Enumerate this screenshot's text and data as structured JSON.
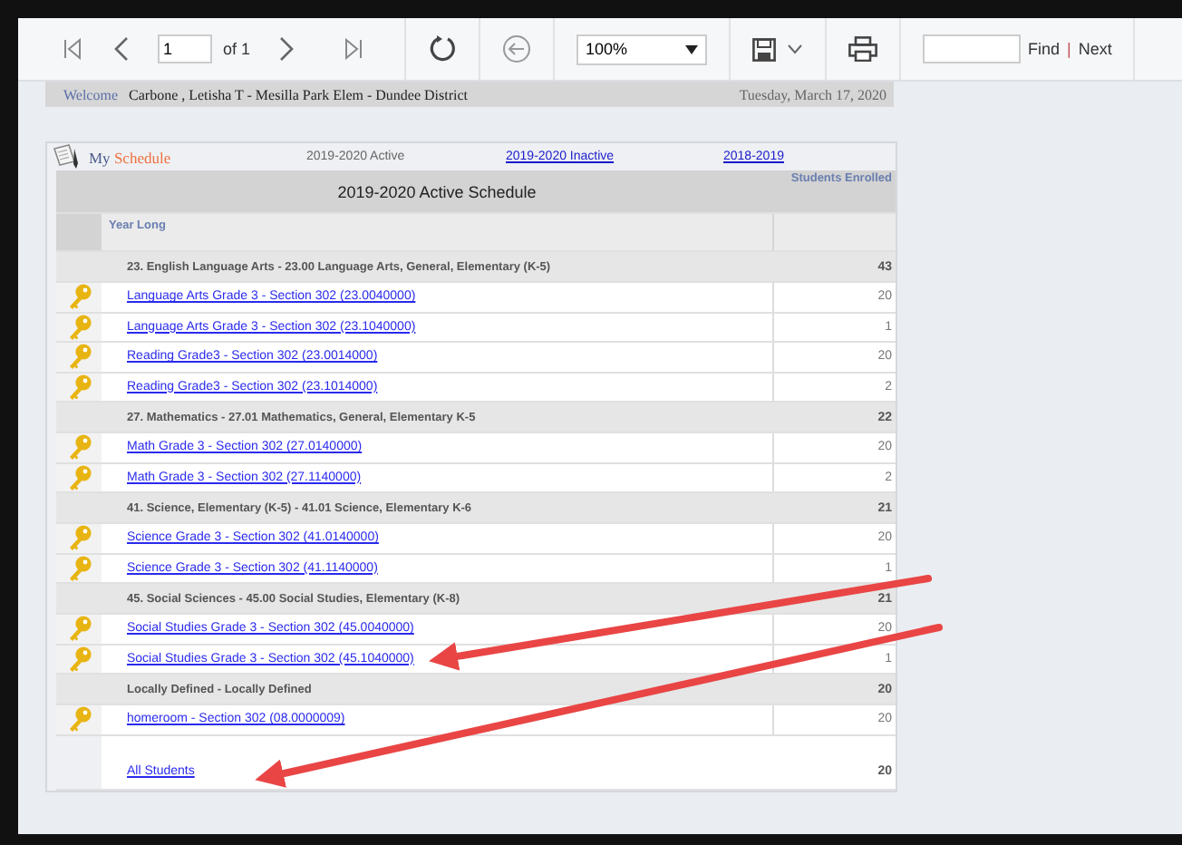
{
  "toolbar": {
    "page": "1",
    "page_count": "of 1",
    "zoom": "100%",
    "find_label": "Find",
    "separator": "|",
    "next_label": "Next"
  },
  "welcome": {
    "label": "Welcome",
    "user": "Carbone , Letisha T - Mesilla Park Elem - Dundee District",
    "date": "Tuesday, March 17, 2020"
  },
  "schedule": {
    "title_prefix": "My",
    "title_word": "Schedule",
    "years": [
      {
        "label": "2019-2020 Active",
        "selected": true
      },
      {
        "label": "2019-2020 Inactive",
        "selected": false
      },
      {
        "label": "2018-2019",
        "selected": false
      }
    ],
    "table_title": "2019-2020 Active Schedule",
    "count_column": "Students Enrolled",
    "term": "Year Long",
    "groups": [
      {
        "name": "23. English Language Arts - 23.00 Language Arts, General, Elementary (K-5)",
        "count": "43",
        "sections": [
          {
            "name": "Language Arts Grade 3 - Section 302 (23.0040000)",
            "count": "20"
          },
          {
            "name": "Language Arts Grade 3 - Section 302 (23.1040000)",
            "count": "1"
          },
          {
            "name": "Reading Grade3 - Section 302 (23.0014000)",
            "count": "20"
          },
          {
            "name": "Reading Grade3 - Section 302 (23.1014000)",
            "count": "2"
          }
        ]
      },
      {
        "name": "27. Mathematics - 27.01 Mathematics, General, Elementary K-5",
        "count": "22",
        "sections": [
          {
            "name": "Math Grade 3 - Section 302 (27.0140000)",
            "count": "20"
          },
          {
            "name": "Math Grade 3 - Section 302 (27.1140000)",
            "count": "2"
          }
        ]
      },
      {
        "name": "41. Science, Elementary (K-5) - 41.01 Science, Elementary K-6",
        "count": "21",
        "sections": [
          {
            "name": "Science Grade 3 - Section 302 (41.0140000)",
            "count": "20"
          },
          {
            "name": "Science Grade 3 - Section 302 (41.1140000)",
            "count": "1"
          }
        ]
      },
      {
        "name": "45. Social Sciences - 45.00 Social Studies, Elementary (K-8)",
        "count": "21",
        "sections": [
          {
            "name": "Social Studies Grade 3 - Section 302 (45.0040000)",
            "count": "20"
          },
          {
            "name": "Social Studies Grade 3 - Section 302 (45.1040000)",
            "count": "1"
          }
        ]
      },
      {
        "name": "Locally Defined - Locally Defined",
        "count": "20",
        "sections": [
          {
            "name": "homeroom - Section 302 (08.0000009)",
            "count": "20"
          }
        ]
      }
    ],
    "total": {
      "label": "All Students",
      "count": "20"
    }
  }
}
